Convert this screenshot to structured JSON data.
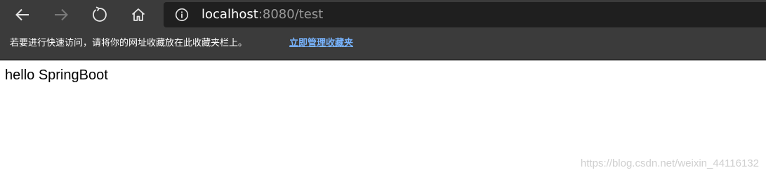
{
  "browser": {
    "nav": {
      "back_icon": "arrow-left-icon",
      "forward_icon": "arrow-right-icon",
      "refresh_icon": "refresh-icon",
      "home_icon": "home-icon"
    },
    "address_bar": {
      "icon": "info-icon",
      "host": "localhost",
      "rest": ":8080/test"
    },
    "favorites_bar": {
      "hint": "若要进行快速访问，请将你的网址收藏放在此收藏夹栏上。",
      "link": "立即管理收藏夹"
    }
  },
  "page": {
    "text": "hello SpringBoot"
  },
  "watermark": "https://blog.csdn.net/weixin_44116132",
  "colors": {
    "toolbar_bg": "#3b3b3b",
    "address_bg": "#1f1f1f",
    "link": "#78b4ff"
  }
}
